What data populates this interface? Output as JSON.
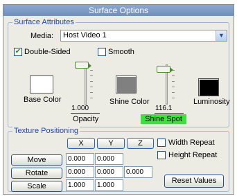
{
  "window": {
    "title": "Surface Options"
  },
  "surface_attributes": {
    "legend": "Surface Attributes",
    "media_label": "Media:",
    "media_value": "Host Video 1",
    "double_sided_label": "Double-Sided",
    "double_sided_checked": true,
    "smooth_label": "Smooth",
    "smooth_checked": false,
    "base_color_label": "Base Color",
    "base_color": "#ffffff",
    "opacity_value": "1.000",
    "opacity_label": "Opacity",
    "shine_color_label": "Shine Color",
    "shine_color": "#808080",
    "shine_spot_value": "116.1",
    "shine_spot_label": "Shine Spot",
    "luminosity_label": "Luminosity",
    "luminosity_color": "#000000",
    "highlight_color": "#3be23b"
  },
  "texture_positioning": {
    "legend": "Texture Positioning",
    "axis_x": "X",
    "axis_y": "Y",
    "axis_z": "Z",
    "width_repeat_label": "Width Repeat",
    "height_repeat_label": "Height Repeat",
    "move_label": "Move",
    "move_x": "0.000",
    "move_y": "0.000",
    "rotate_label": "Rotate",
    "rotate_x": "0.000",
    "rotate_y": "0.000",
    "rotate_z": "0.000",
    "scale_label": "Scale",
    "scale_x": "1.000",
    "scale_y": "1.000",
    "reset_label": "Reset Values"
  }
}
